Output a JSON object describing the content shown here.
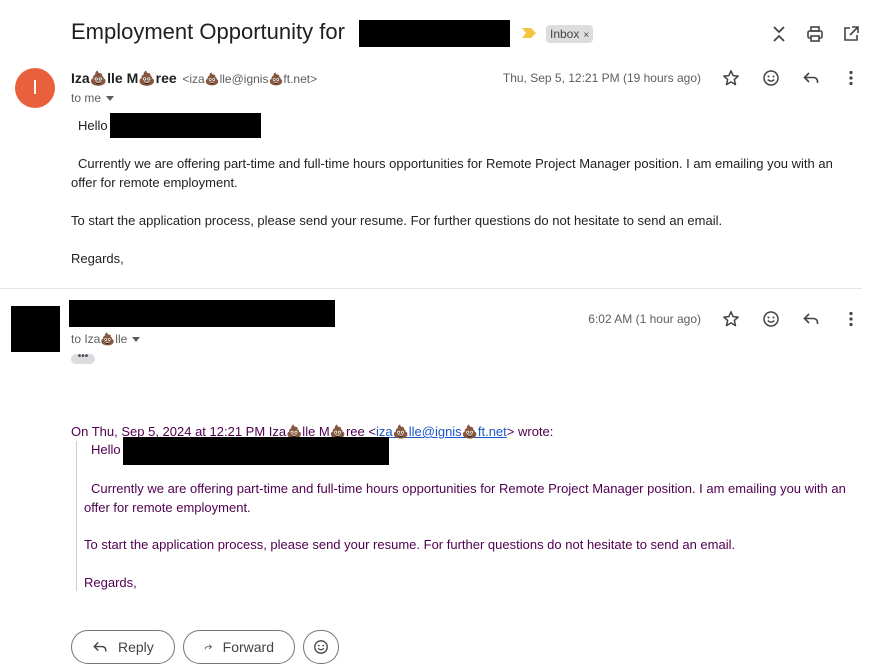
{
  "subject": "Employment Opportunity for",
  "label": {
    "text": "Inbox",
    "remove": "×"
  },
  "colors": {
    "avatar": "#e8603c",
    "important_tag": "#f4c542",
    "quote_text": "#500050",
    "link": "#1a57c9",
    "redaction": "#000000"
  },
  "icons": [
    "expand-collapse-icon",
    "print-icon",
    "open-new-window-icon",
    "star-icon",
    "emoji-reaction-icon",
    "reply-icon",
    "more-vert-icon",
    "forward-icon"
  ],
  "message1": {
    "avatar_letter": "I",
    "sender_name": "Iza💩lle M💩ree",
    "sender_email": "<iza💩lle@ignis💩ft.net>",
    "recipient": "to me",
    "date": "Thu, Sep 5, 12:21 PM (19 hours ago)",
    "greeting": "Hello",
    "para1": "Currently we are offering part-time and full-time hours opportunities for Remote Project Manager position. I am emailing you with an offer for remote employment.",
    "para2": "To start the application process, please send your resume. For further questions do not hesitate to send an email.",
    "closing": "Regards,"
  },
  "message2": {
    "recipient": "to Iza💩lle",
    "date": "6:02 AM (1 hour ago)",
    "trimmed": "•••",
    "quote_prefix": "On Thu, Sep 5, 2024 at 12:21 PM Iza💩lle M💩ree <",
    "quote_email": "iza💩lle@ignis💩ft.net",
    "quote_suffix": "> wrote:",
    "quote_greeting": "Hello",
    "quote_para1": "Currently we are offering part-time and full-time hours opportunities for Remote Project Manager position. I am emailing you with an offer for remote employment.",
    "quote_para2": "To start the application process, please send your resume. For further questions do not hesitate to send an email.",
    "quote_closing": "Regards,"
  },
  "actions": {
    "reply": "Reply",
    "forward": "Forward"
  }
}
